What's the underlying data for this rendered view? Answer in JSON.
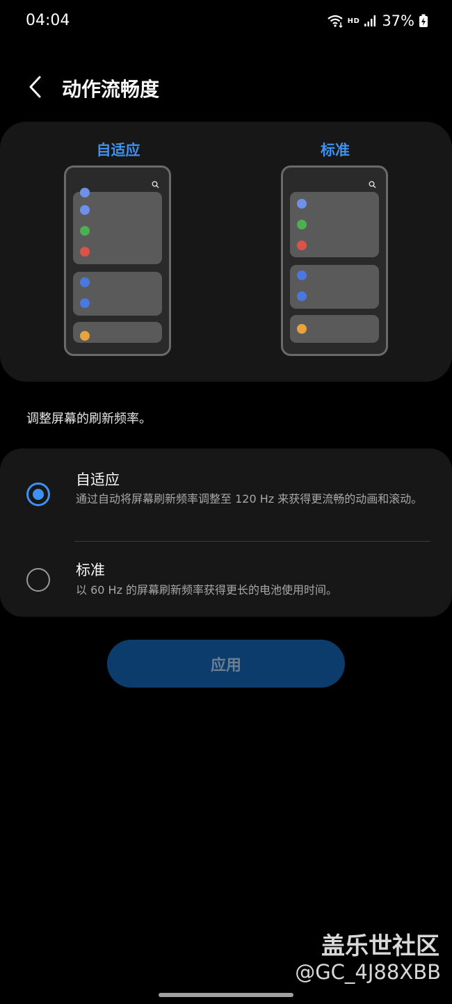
{
  "status_bar": {
    "time": "04:04",
    "network": "HD",
    "battery": "37%"
  },
  "header": {
    "title": "动作流畅度"
  },
  "preview": {
    "adaptive_label": "自适应",
    "standard_label": "标准"
  },
  "description": "调整屏幕的刷新频率。",
  "options": [
    {
      "title": "自适应",
      "description": "通过自动将屏幕刷新频率调整至 120 Hz 来获得更流畅的动画和滚动。",
      "selected": true
    },
    {
      "title": "标准",
      "description": "以 60 Hz 的屏幕刷新频率获得更长的电池使用时间。",
      "selected": false
    }
  ],
  "apply_button": {
    "label": "应用"
  },
  "watermark": {
    "title": "盖乐世社区",
    "user": "@GC_4J88XBB"
  },
  "colors": {
    "accent": "#3e91f0",
    "dot_blue_light": "#6f8fe8",
    "dot_blue": "#4a78e0",
    "dot_green": "#4caf50",
    "dot_red": "#d9534a",
    "dot_orange": "#e8a33a",
    "button_bg": "#0b3c6b"
  }
}
